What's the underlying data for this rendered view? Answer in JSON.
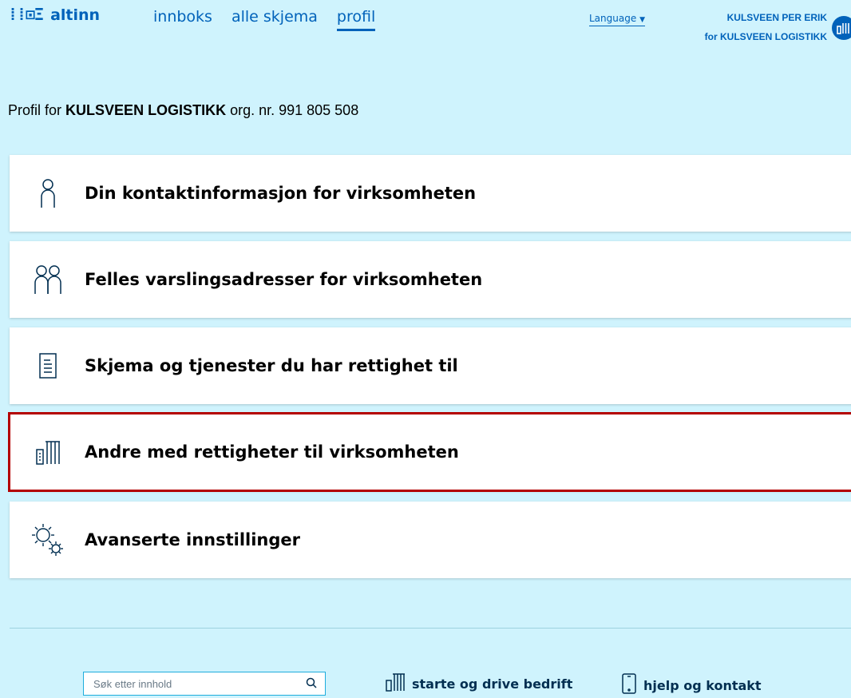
{
  "header": {
    "logo_text": "altinn",
    "nav": [
      {
        "label": "innboks",
        "active": false
      },
      {
        "label": "alle skjema",
        "active": false
      },
      {
        "label": "profil",
        "active": true
      }
    ],
    "language_label": "Language",
    "user_name": "KULSVEEN PER ERIK",
    "user_org": "for KULSVEEN LOGISTIKK"
  },
  "profile": {
    "prefix": "Profil for",
    "org_name": "KULSVEEN LOGISTIKK",
    "org_nr_text": "org. nr. 991 805 508"
  },
  "cards": [
    {
      "label": "Din kontaktinformasjon for virksomheten",
      "icon": "person-icon"
    },
    {
      "label": "Felles varslingsadresser for virksomheten",
      "icon": "people-icon"
    },
    {
      "label": "Skjema og tjenester du har rettighet til",
      "icon": "document-icon"
    },
    {
      "label": "Andre med rettigheter til virksomheten",
      "icon": "building-icon",
      "highlighted": true
    },
    {
      "label": "Avanserte innstillinger",
      "icon": "gears-icon"
    }
  ],
  "footer": {
    "search_placeholder": "Søk etter innhold",
    "links": [
      {
        "label": "starte og drive bedrift",
        "icon": "building-icon"
      },
      {
        "label": "hjelp og kontakt",
        "icon": "phone-icon"
      }
    ]
  },
  "colors": {
    "background": "#cff3fd",
    "brand": "#0062ba",
    "highlight": "#b40000"
  }
}
